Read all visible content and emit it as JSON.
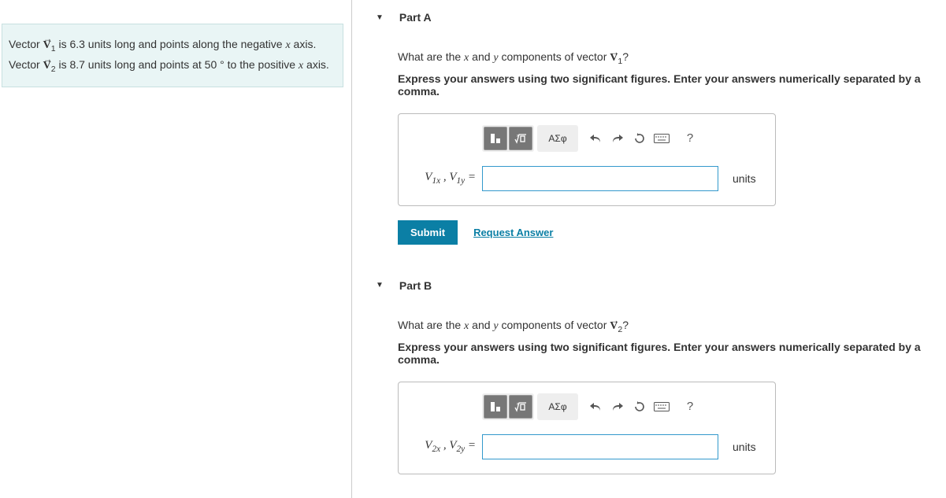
{
  "problem": {
    "full_html": "Vector <span class='vec'>V</span><sub>1</sub> is 6.3 units long and points along the negative <span class='serif-it'>x</span> axis. Vector <span class='vec'>V</span><sub>2</sub> is 8.7 units long and points at 50 ° to the positive <span class='serif-it'>x</span> axis."
  },
  "parts": {
    "a": {
      "title": "Part A",
      "question_html": "What are the <span class='serif-it'>x</span> and <span class='serif-it'>y</span> components of vector <span class='vec'>V</span><sub>1</sub>?",
      "instruction": "Express your answers using two significant figures. Enter your answers numerically separated by a comma.",
      "label_html": "<span class='serif-it'>V</span><sub>1<span class='serif-it'>x</span></sub> , <span class='serif-it'>V</span><sub>1<span class='serif-it'>y</span></sub> =",
      "units": "units",
      "submit": "Submit",
      "request": "Request Answer"
    },
    "b": {
      "title": "Part B",
      "question_html": "What are the <span class='serif-it'>x</span> and <span class='serif-it'>y</span> components of vector <span class='vec'>V</span><sub>2</sub>?",
      "instruction": "Express your answers using two significant figures. Enter your answers numerically separated by a comma.",
      "label_html": "<span class='serif-it'>V</span><sub>2<span class='serif-it'>x</span></sub> , <span class='serif-it'>V</span><sub>2<span class='serif-it'>y</span></sub> =",
      "units": "units"
    }
  },
  "toolbar": {
    "greek": "ΑΣφ",
    "help": "?"
  }
}
